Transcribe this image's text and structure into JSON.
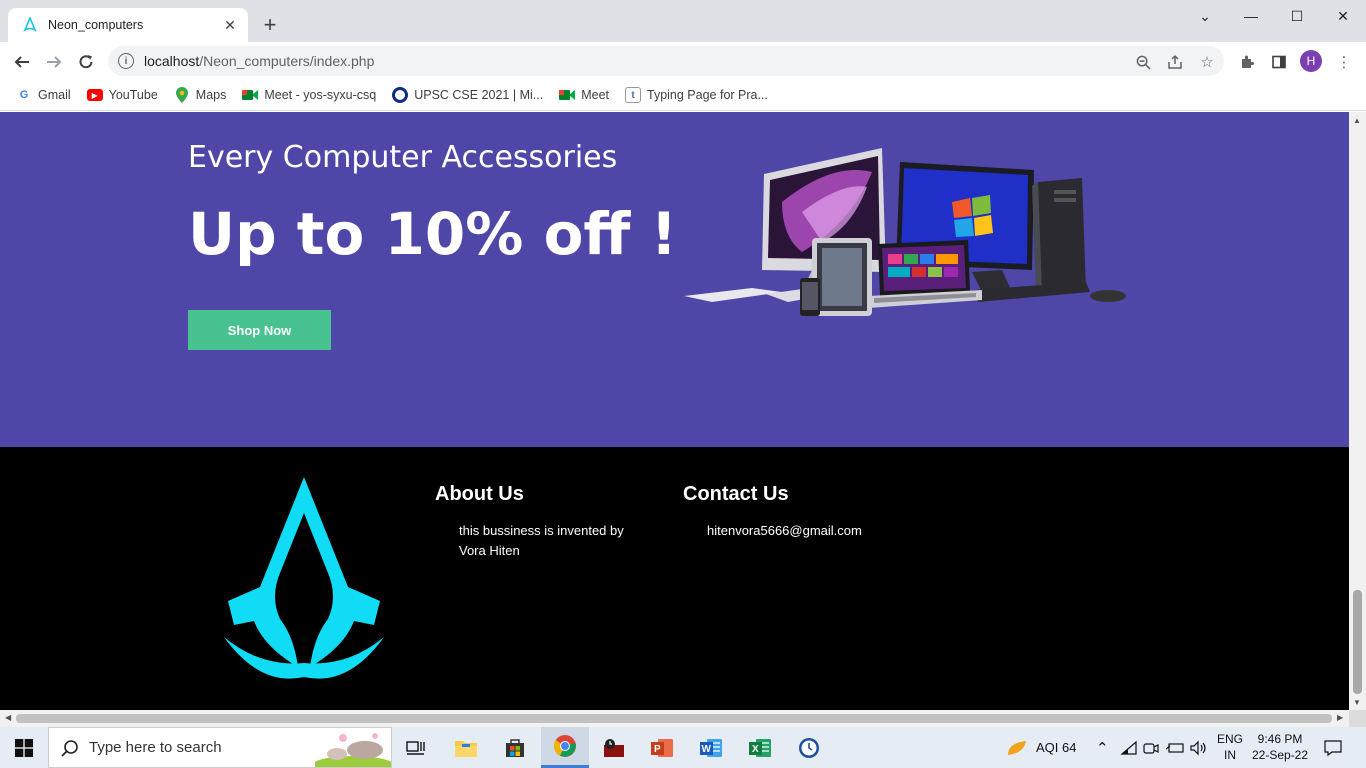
{
  "browser": {
    "tab_title": "Neon_computers",
    "url_host": "localhost",
    "url_path": "/Neon_computers/index.php",
    "profile_initial": "H",
    "bookmarks": [
      {
        "label": "Gmail",
        "icon": "gmail-icon"
      },
      {
        "label": "YouTube",
        "icon": "youtube-icon"
      },
      {
        "label": "Maps",
        "icon": "maps-icon"
      },
      {
        "label": "Meet - yos-syxu-csq",
        "icon": "meet-icon"
      },
      {
        "label": "UPSC CSE 2021 | Mi...",
        "icon": "upsc-icon"
      },
      {
        "label": "Meet",
        "icon": "meet-icon"
      },
      {
        "label": "Typing Page for Pra...",
        "icon": "typing-icon"
      }
    ]
  },
  "hero": {
    "subtitle": "Every Computer Accessories",
    "title": "Up to 10% off !",
    "button": "Shop Now",
    "bg_color": "#4f47a8",
    "button_color": "#48c290"
  },
  "footer": {
    "about_title": "About Us",
    "about_text_1": "this bussiness is invented by",
    "about_text_2": "Vora Hiten",
    "contact_title": "Contact Us",
    "contact_email": "hitenvora5666@gmail.com",
    "logo_color": "#10dcf5"
  },
  "taskbar": {
    "search_placeholder": "Type here to search",
    "aqi": "AQI 64",
    "lang_1": "ENG",
    "lang_2": "IN",
    "time": "9:46 PM",
    "date": "22-Sep-22"
  }
}
